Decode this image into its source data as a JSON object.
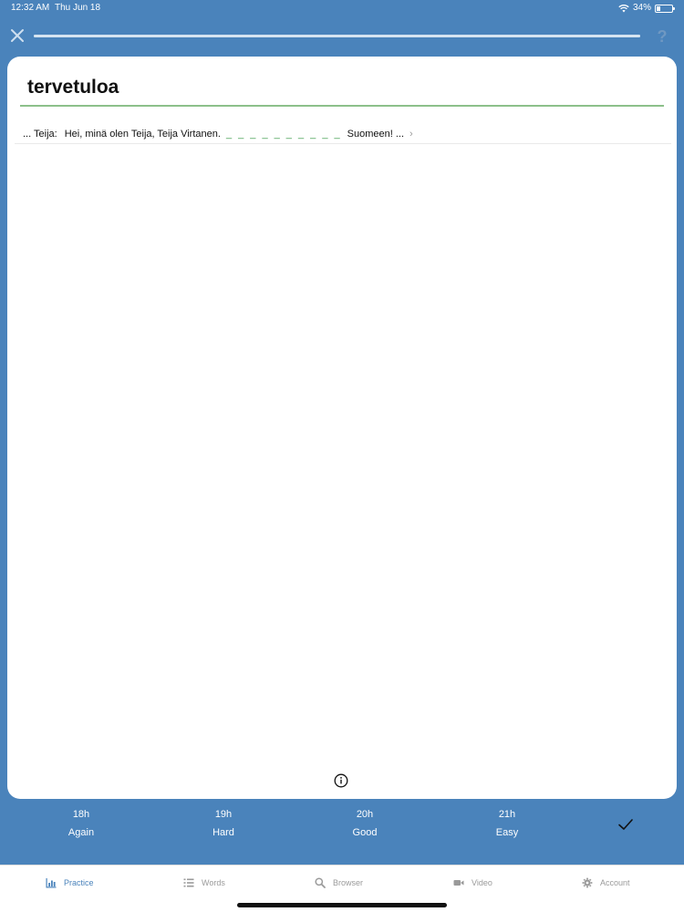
{
  "status_bar": {
    "time": "12:32 AM",
    "date": "Thu Jun 18",
    "battery": "34%",
    "battery_level": 0.34
  },
  "top_bar": {
    "help_label": "?",
    "progress": 1.0
  },
  "card": {
    "word": "tervetuloa",
    "sentence": {
      "lead": "... Teija:",
      "text": "Hei, minä olen Teija, Teija Virtanen.",
      "blank": "_ _ _ _ _ _ _ _ _ _",
      "tail": "Suomeen! ...",
      "chevron": "›"
    }
  },
  "answers": [
    {
      "time": "18h",
      "label": "Again"
    },
    {
      "time": "19h",
      "label": "Hard"
    },
    {
      "time": "20h",
      "label": "Good"
    },
    {
      "time": "21h",
      "label": "Easy"
    }
  ],
  "tabs": [
    {
      "label": "Practice",
      "icon": "bar-chart-icon",
      "active": true
    },
    {
      "label": "Words",
      "icon": "list-icon"
    },
    {
      "label": "Browser",
      "icon": "magnifier-icon"
    },
    {
      "label": "Video",
      "icon": "video-camera-icon"
    },
    {
      "label": "Account",
      "icon": "gear-icon"
    }
  ],
  "colors": {
    "background": "#4a83bb",
    "accent_green": "#8cc08a",
    "active_tab": "#4a83bb"
  }
}
